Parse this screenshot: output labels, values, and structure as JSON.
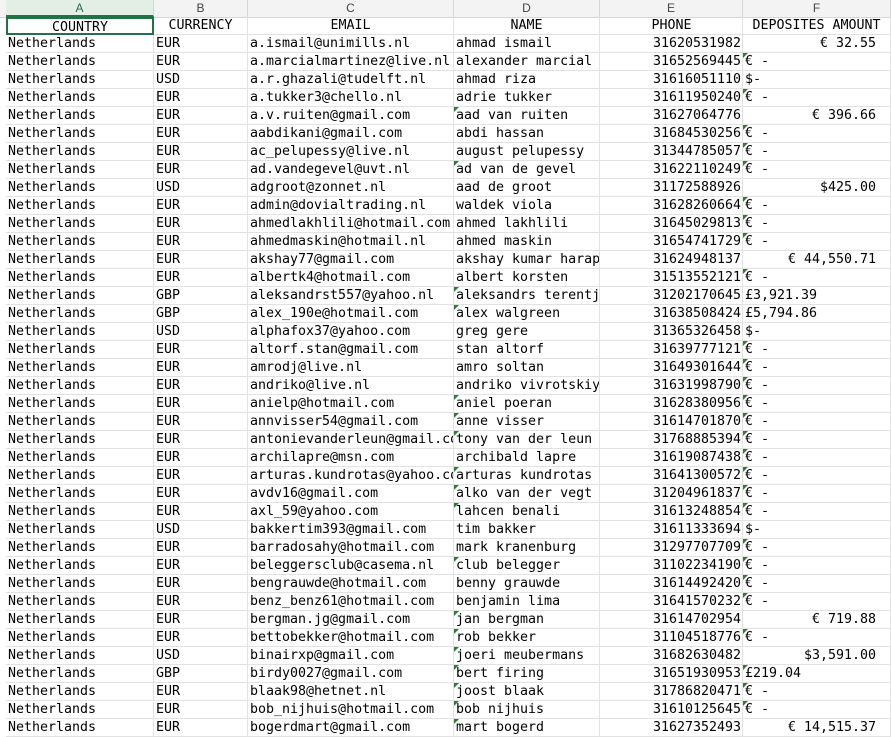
{
  "columns": [
    "A",
    "B",
    "C",
    "D",
    "E",
    "F"
  ],
  "header": [
    "COUNTRY",
    "CURRENCY",
    "EMAIL",
    "NAME",
    "PHONE",
    "DEPOSITES AMOUNT"
  ],
  "rows": [
    {
      "country": "Netherlands",
      "currency": "EUR",
      "email": "a.ismail@unimills.nl",
      "name": "ahmad ismail",
      "phone": "31620531982",
      "amount": "€  32.55",
      "align": "right",
      "ntri": false,
      "ptri": false
    },
    {
      "country": "Netherlands",
      "currency": "EUR",
      "email": "a.marcialmartinez@live.nl",
      "name": "alexander marcial",
      "phone": "31652569445",
      "amount": "€ -",
      "align": "left",
      "ntri": false,
      "ptri": true
    },
    {
      "country": "Netherlands",
      "currency": "USD",
      "email": "a.r.ghazali@tudelft.nl",
      "name": "ahmad riza",
      "phone": "31616051110",
      "amount": "$-",
      "align": "left",
      "ntri": false,
      "ptri": false
    },
    {
      "country": "Netherlands",
      "currency": "EUR",
      "email": "a.tukker3@chello.nl",
      "name": "adrie tukker",
      "phone": "31611950240",
      "amount": "€ -",
      "align": "left",
      "ntri": false,
      "ptri": true
    },
    {
      "country": "Netherlands",
      "currency": "EUR",
      "email": "a.v.ruiten@gmail.com",
      "name": "aad van ruiten",
      "phone": "31627064776",
      "amount": "€  396.66",
      "align": "right",
      "ntri": true,
      "ptri": false
    },
    {
      "country": "Netherlands",
      "currency": "EUR",
      "email": "aabdikani@gmail.com",
      "name": "abdi hassan",
      "phone": "31684530256",
      "amount": "€ -",
      "align": "left",
      "ntri": false,
      "ptri": true
    },
    {
      "country": "Netherlands",
      "currency": "EUR",
      "email": "ac_pelupessy@live.nl",
      "name": "august pelupessy",
      "phone": "31344785057",
      "amount": "€ -",
      "align": "left",
      "ntri": false,
      "ptri": true
    },
    {
      "country": "Netherlands",
      "currency": "EUR",
      "email": "ad.vandegevel@uvt.nl",
      "name": "ad van de gevel",
      "phone": "31622110249",
      "amount": "€ -",
      "align": "left",
      "ntri": true,
      "ptri": true
    },
    {
      "country": "Netherlands",
      "currency": "USD",
      "email": "adgroot@zonnet.nl",
      "name": "aad de groot",
      "phone": "31172588926",
      "amount": "$425.00",
      "align": "right",
      "ntri": false,
      "ptri": false
    },
    {
      "country": "Netherlands",
      "currency": "EUR",
      "email": "admin@dovialtrading.nl",
      "name": "waldek viola",
      "phone": "31628260664",
      "amount": "€ -",
      "align": "left",
      "ntri": false,
      "ptri": true
    },
    {
      "country": "Netherlands",
      "currency": "EUR",
      "email": "ahmedlakhlili@hotmail.com",
      "name": "ahmed lakhlili",
      "phone": "31645029813",
      "amount": "€ -",
      "align": "left",
      "ntri": false,
      "ptri": true
    },
    {
      "country": "Netherlands",
      "currency": "EUR",
      "email": "ahmedmaskin@hotmail.nl",
      "name": "ahmed maskin",
      "phone": "31654741729",
      "amount": "€ -",
      "align": "left",
      "ntri": false,
      "ptri": true
    },
    {
      "country": "Netherlands",
      "currency": "EUR",
      "email": "akshay77@gmail.com",
      "name": "akshay kumar harap",
      "phone": "31624948137",
      "amount": "€  44,550.71",
      "align": "right",
      "ntri": false,
      "ptri": false
    },
    {
      "country": "Netherlands",
      "currency": "EUR",
      "email": "albertk4@hotmail.com",
      "name": "albert korsten",
      "phone": "31513552121",
      "amount": "€ -",
      "align": "left",
      "ntri": false,
      "ptri": true
    },
    {
      "country": "Netherlands",
      "currency": "GBP",
      "email": "aleksandrst557@yahoo.nl",
      "name": "aleksandrs terentj",
      "phone": "31202170645",
      "amount": "£3,921.39",
      "align": "left",
      "ntri": true,
      "ptri": false
    },
    {
      "country": "Netherlands",
      "currency": "GBP",
      "email": "alex_190e@hotmail.com",
      "name": "alex walgreen",
      "phone": "31638508424",
      "amount": "£5,794.86",
      "align": "left",
      "ntri": true,
      "ptri": false
    },
    {
      "country": "Netherlands",
      "currency": "USD",
      "email": "alphafox37@yahoo.com",
      "name": "greg gere",
      "phone": "31365326458",
      "amount": "$-",
      "align": "left",
      "ntri": false,
      "ptri": false
    },
    {
      "country": "Netherlands",
      "currency": "EUR",
      "email": "altorf.stan@gmail.com",
      "name": "stan altorf",
      "phone": "31639777121",
      "amount": "€ -",
      "align": "left",
      "ntri": false,
      "ptri": true
    },
    {
      "country": "Netherlands",
      "currency": "EUR",
      "email": "amrodj@live.nl",
      "name": "amro soltan",
      "phone": "31649301644",
      "amount": "€ -",
      "align": "left",
      "ntri": false,
      "ptri": true
    },
    {
      "country": "Netherlands",
      "currency": "EUR",
      "email": "andriko@live.nl",
      "name": "andriko vivrotskiy",
      "phone": "31631998790",
      "amount": "€ -",
      "align": "left",
      "ntri": false,
      "ptri": true
    },
    {
      "country": "Netherlands",
      "currency": "EUR",
      "email": "anielp@hotmail.com",
      "name": "aniel poeran",
      "phone": "31628380956",
      "amount": "€ -",
      "align": "left",
      "ntri": true,
      "ptri": true
    },
    {
      "country": "Netherlands",
      "currency": "EUR",
      "email": "annvisser54@gmail.com",
      "name": "anne visser",
      "phone": "31614701870",
      "amount": "€ -",
      "align": "left",
      "ntri": true,
      "ptri": true
    },
    {
      "country": "Netherlands",
      "currency": "EUR",
      "email": "antonievanderleun@gmail.com",
      "name": "tony van der leun",
      "phone": "31768885394",
      "amount": "€ -",
      "align": "left",
      "ntri": true,
      "ptri": true
    },
    {
      "country": "Netherlands",
      "currency": "EUR",
      "email": "archilapre@msn.com",
      "name": "archibald lapre",
      "phone": "31619087438",
      "amount": "€ -",
      "align": "left",
      "ntri": false,
      "ptri": true
    },
    {
      "country": "Netherlands",
      "currency": "EUR",
      "email": "arturas.kundrotas@yahoo.com",
      "name": "arturas kundrotas",
      "phone": "31641300572",
      "amount": "€ -",
      "align": "left",
      "ntri": true,
      "ptri": true
    },
    {
      "country": "Netherlands",
      "currency": "EUR",
      "email": "avdv16@gmail.com",
      "name": "alko van der vegt",
      "phone": "31204961837",
      "amount": "€ -",
      "align": "left",
      "ntri": true,
      "ptri": true
    },
    {
      "country": "Netherlands",
      "currency": "EUR",
      "email": "axl_59@yahoo.com",
      "name": "lahcen benali",
      "phone": "31613248854",
      "amount": "€ -",
      "align": "left",
      "ntri": true,
      "ptri": true
    },
    {
      "country": "Netherlands",
      "currency": "USD",
      "email": "bakkertim393@gmail.com",
      "name": "tim bakker",
      "phone": "31611333694",
      "amount": "$-",
      "align": "left",
      "ntri": false,
      "ptri": false
    },
    {
      "country": "Netherlands",
      "currency": "EUR",
      "email": "barradosahy@hotmail.com",
      "name": "mark kranenburg",
      "phone": "31297707709",
      "amount": "€ -",
      "align": "left",
      "ntri": false,
      "ptri": true
    },
    {
      "country": "Netherlands",
      "currency": "EUR",
      "email": "beleggersclub@casema.nl",
      "name": "club belegger",
      "phone": "31102234190",
      "amount": "€ -",
      "align": "left",
      "ntri": true,
      "ptri": true
    },
    {
      "country": "Netherlands",
      "currency": "EUR",
      "email": "bengrauwde@hotmail.com",
      "name": "benny grauwde",
      "phone": "31614492420",
      "amount": "€ -",
      "align": "left",
      "ntri": false,
      "ptri": true
    },
    {
      "country": "Netherlands",
      "currency": "EUR",
      "email": "benz_benz61@hotmail.com",
      "name": "benjamin lima",
      "phone": "31641570232",
      "amount": "€ -",
      "align": "left",
      "ntri": false,
      "ptri": true
    },
    {
      "country": "Netherlands",
      "currency": "EUR",
      "email": "bergman.jg@gmail.com",
      "name": "jan bergman",
      "phone": "31614702954",
      "amount": "€  719.88",
      "align": "right",
      "ntri": true,
      "ptri": false
    },
    {
      "country": "Netherlands",
      "currency": "EUR",
      "email": "bettobekker@hotmail.com",
      "name": "rob bekker",
      "phone": "31104518776",
      "amount": "€ -",
      "align": "left",
      "ntri": true,
      "ptri": true
    },
    {
      "country": "Netherlands",
      "currency": "USD",
      "email": "binairxp@gmail.com",
      "name": "joeri meubermans",
      "phone": "31682630482",
      "amount": "$3,591.00",
      "align": "right",
      "ntri": true,
      "ptri": false
    },
    {
      "country": "Netherlands",
      "currency": "GBP",
      "email": "birdy0027@gmail.com",
      "name": "bert firing",
      "phone": "31651930953",
      "amount": "£219.04",
      "align": "left",
      "ntri": true,
      "ptri": true
    },
    {
      "country": "Netherlands",
      "currency": "EUR",
      "email": "blaak98@hetnet.nl",
      "name": "joost blaak",
      "phone": "31786820471",
      "amount": "€ -",
      "align": "left",
      "ntri": true,
      "ptri": true
    },
    {
      "country": "Netherlands",
      "currency": "EUR",
      "email": "bob_nijhuis@hotmail.com",
      "name": "bob nijhuis",
      "phone": "31610125645",
      "amount": "€ -",
      "align": "left",
      "ntri": true,
      "ptri": true
    },
    {
      "country": "Netherlands",
      "currency": "EUR",
      "email": "bogerdmart@gmail.com",
      "name": "mart bogerd",
      "phone": "31627352493",
      "amount": "€  14,515.37",
      "align": "right",
      "ntri": true,
      "ptri": false
    }
  ]
}
